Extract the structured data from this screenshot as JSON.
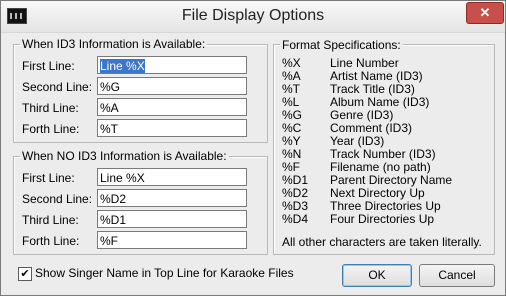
{
  "window": {
    "title": "File Display Options"
  },
  "id3_group": {
    "title": "When ID3 Information is Available:",
    "rows": [
      {
        "label": "First Line:",
        "value": "Line %X"
      },
      {
        "label": "Second Line:",
        "value": "%G"
      },
      {
        "label": "Third Line:",
        "value": "%A"
      },
      {
        "label": "Forth Line:",
        "value": "%T"
      }
    ]
  },
  "noid3_group": {
    "title": "When NO ID3 Information is Available:",
    "rows": [
      {
        "label": "First Line:",
        "value": "Line %X"
      },
      {
        "label": "Second Line:",
        "value": "%D2"
      },
      {
        "label": "Third Line:",
        "value": "%D1"
      },
      {
        "label": "Forth Line:",
        "value": "%F"
      }
    ]
  },
  "format_spec": {
    "title": "Format Specifications:",
    "items": [
      {
        "code": "%X",
        "desc": "Line Number"
      },
      {
        "code": "%A",
        "desc": "Artist Name (ID3)"
      },
      {
        "code": "%T",
        "desc": "Track Title (ID3)"
      },
      {
        "code": "%L",
        "desc": "Album Name (ID3)"
      },
      {
        "code": "%G",
        "desc": "Genre (ID3)"
      },
      {
        "code": "%C",
        "desc": "Comment (ID3)"
      },
      {
        "code": "%Y",
        "desc": "Year (ID3)"
      },
      {
        "code": "%N",
        "desc": "Track Number (ID3)"
      },
      {
        "code": "%F",
        "desc": "Filename (no path)"
      },
      {
        "code": "%D1",
        "desc": "Parent Directory Name"
      },
      {
        "code": "%D2",
        "desc": "Next Directory Up"
      },
      {
        "code": "%D3",
        "desc": "Three Directories Up"
      },
      {
        "code": "%D4",
        "desc": "Four Directories Up"
      }
    ],
    "note": "All other characters are taken literally."
  },
  "checkbox": {
    "label": "Show Singer Name in Top Line for Karaoke Files",
    "checked": true,
    "mark": "✔"
  },
  "buttons": {
    "ok": "OK",
    "cancel": "Cancel"
  },
  "close_glyph": "✕"
}
